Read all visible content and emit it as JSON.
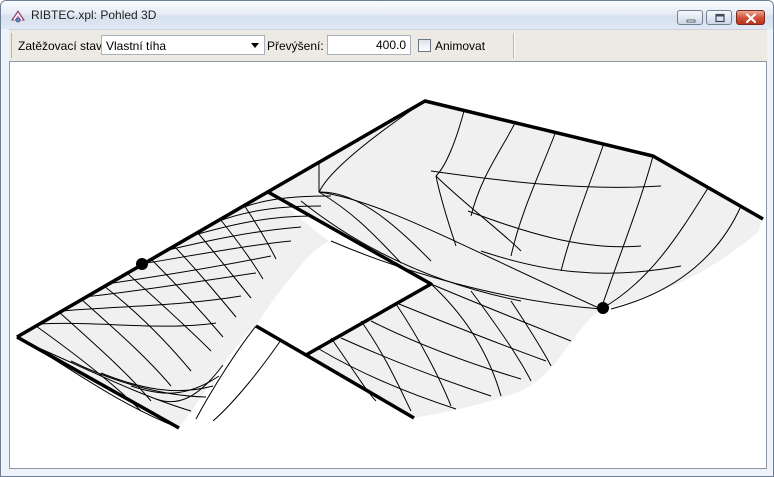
{
  "window": {
    "title": "RIBTEC.xpl: Pohled 3D",
    "app_icon": "ribtec-app-icon",
    "controls": {
      "minimize": "minimize-icon",
      "maximize": "maximize-icon",
      "close": "close-icon"
    }
  },
  "toolbar": {
    "load_state_label": "Zatěžovací stav:",
    "load_state_value": "Vlastní tíha",
    "exaggeration_label": "Převýšení:",
    "exaggeration_value": "400.0",
    "animate_label": "Animovat",
    "animate_checked": false
  },
  "viewport": {
    "background": "#ffffff",
    "surface_fill": "#f0f0f0",
    "mesh_color": "#000000",
    "edge_color": "#000000"
  }
}
